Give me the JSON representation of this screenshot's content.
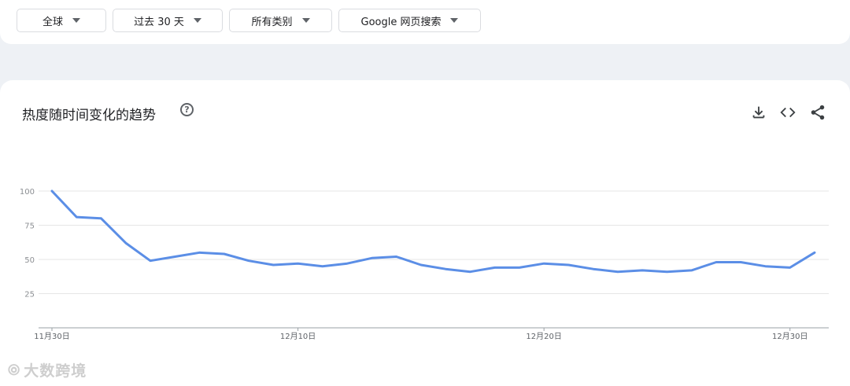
{
  "filters": {
    "region": "全球",
    "time": "过去 30 天",
    "category": "所有类别",
    "source": "Google 网页搜索"
  },
  "card": {
    "title": "热度随时间变化的趋势",
    "help_icon": "help-circle-icon",
    "tools": [
      "download-icon",
      "embed-code-icon",
      "share-icon"
    ]
  },
  "watermark": "大数跨境",
  "colors": {
    "line": "#5b8ee6",
    "grid": "#e6e6e6",
    "axis": "#8c8f93"
  },
  "chart_data": {
    "type": "line",
    "title": "",
    "xlabel": "",
    "ylabel": "",
    "ylim": [
      0,
      100
    ],
    "yticks": [
      25,
      50,
      75,
      100
    ],
    "grid": true,
    "x": [
      "11月30日",
      "12月1日",
      "12月2日",
      "12月3日",
      "12月4日",
      "12月5日",
      "12月6日",
      "12月7日",
      "12月8日",
      "12月9日",
      "12月10日",
      "12月11日",
      "12月12日",
      "12月13日",
      "12月14日",
      "12月15日",
      "12月16日",
      "12月17日",
      "12月18日",
      "12月19日",
      "12月20日",
      "12月21日",
      "12月22日",
      "12月23日",
      "12月24日",
      "12月25日",
      "12月26日",
      "12月27日",
      "12月28日",
      "12月29日",
      "12月30日",
      "12月31日"
    ],
    "x_tick_labels": [
      "11月30日",
      "12月10日",
      "12月20日",
      "12月30日"
    ],
    "x_tick_indices": [
      0,
      10,
      20,
      30
    ],
    "series": [
      {
        "values": [
          100,
          81,
          80,
          62,
          49,
          52,
          55,
          54,
          49,
          46,
          47,
          45,
          47,
          51,
          52,
          46,
          43,
          41,
          44,
          44,
          47,
          46,
          43,
          41,
          42,
          41,
          42,
          48,
          48,
          45,
          44,
          55
        ]
      }
    ]
  }
}
